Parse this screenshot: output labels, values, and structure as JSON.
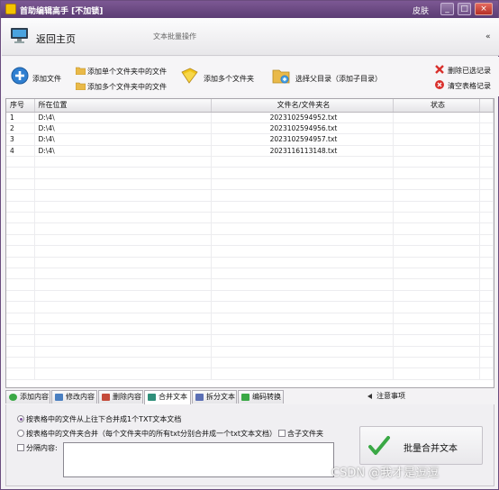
{
  "window": {
    "title": "首助编辑高手 [不加锁]",
    "skin_label": "皮肤"
  },
  "header": {
    "home_label": "返回主页",
    "subtitle": "文本批量操作",
    "collapse_label": "«"
  },
  "toolbar": {
    "add_file": "添加文件",
    "add_single_folder_files": "添加单个文件夹中的文件",
    "add_multi_folder_files": "添加多个文件夹中的文件",
    "add_multi_folders": "添加多个文件夹",
    "select_parent_dir": "选择父目录（添加子目录）",
    "delete_selected": "删除已选记录",
    "clear_table": "清空表格记录"
  },
  "table": {
    "columns": [
      "序号",
      "所在位置",
      "文件名/文件夹名",
      "状态"
    ],
    "rows": [
      {
        "index": "1",
        "location": "D:\\4\\",
        "name": "2023102594952.txt",
        "status": ""
      },
      {
        "index": "2",
        "location": "D:\\4\\",
        "name": "2023102594956.txt",
        "status": ""
      },
      {
        "index": "3",
        "location": "D:\\4\\",
        "name": "2023102594957.txt",
        "status": ""
      },
      {
        "index": "4",
        "location": "D:\\4\\",
        "name": "2023116113148.txt",
        "status": ""
      }
    ]
  },
  "tabs": [
    "添加内容",
    "修改内容",
    "删除内容",
    "合并文本",
    "拆分文本",
    "编码转换"
  ],
  "active_tab": "合并文本",
  "notice_label": "注意事项",
  "merge_panel": {
    "option1": "按表格中的文件从上往下合并成1个TXT文本文档",
    "option2": "按表格中的文件夹合并（每个文件夹中的所有txt分别合并成一个txt文本文档）",
    "include_subfolders": "含子文件夹",
    "separator_label": "分隔内容:",
    "separator_value": "",
    "merge_button": "批量合并文本"
  },
  "watermark": "CSDN @我才是逗逗",
  "colors": {
    "titlebar": "#6b4a82",
    "accent": "#7a4f9a"
  }
}
